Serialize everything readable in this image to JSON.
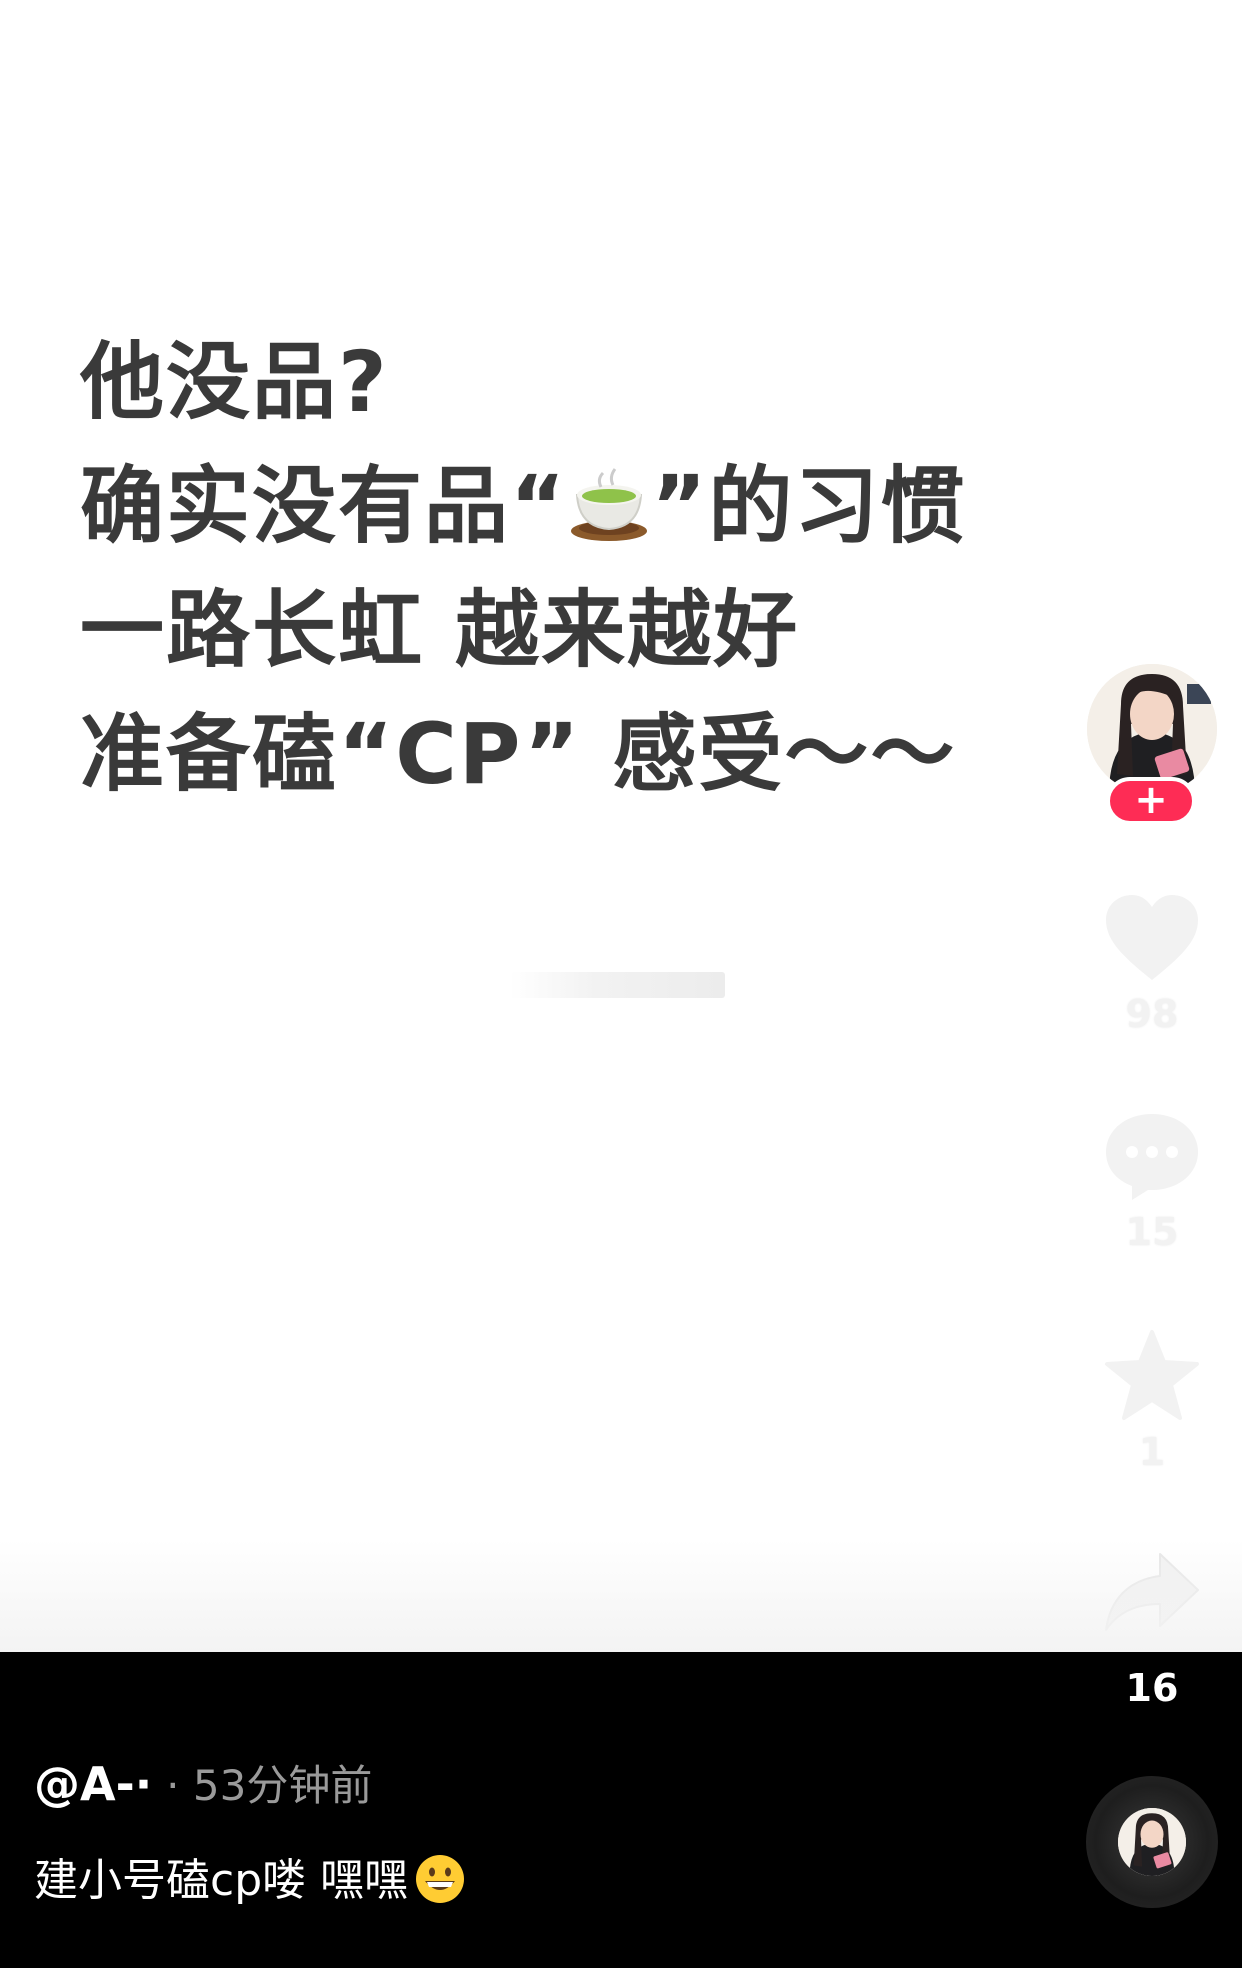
{
  "post": {
    "line1": "他没品?",
    "line2_before": "确实没有品“",
    "line2_emoji": "tea-emoji",
    "line2_after": "”的习惯",
    "line3": "一路长虹 越来越好",
    "line4": "准备磕“CP” 感受～～"
  },
  "rail": {
    "avatar": "creator-avatar",
    "follow_label": "+",
    "likes": "98",
    "comments": "15",
    "favorites": "1",
    "shares": "16"
  },
  "footer": {
    "author": "@A-·",
    "time": "· 53分钟前",
    "caption": "建小号磕cp喽 嘿嘿",
    "caption_emoji": "grinning-face-emoji"
  },
  "colors": {
    "follow": "#fe2c55",
    "text": "#3a3a3a",
    "bar": "#000000"
  }
}
